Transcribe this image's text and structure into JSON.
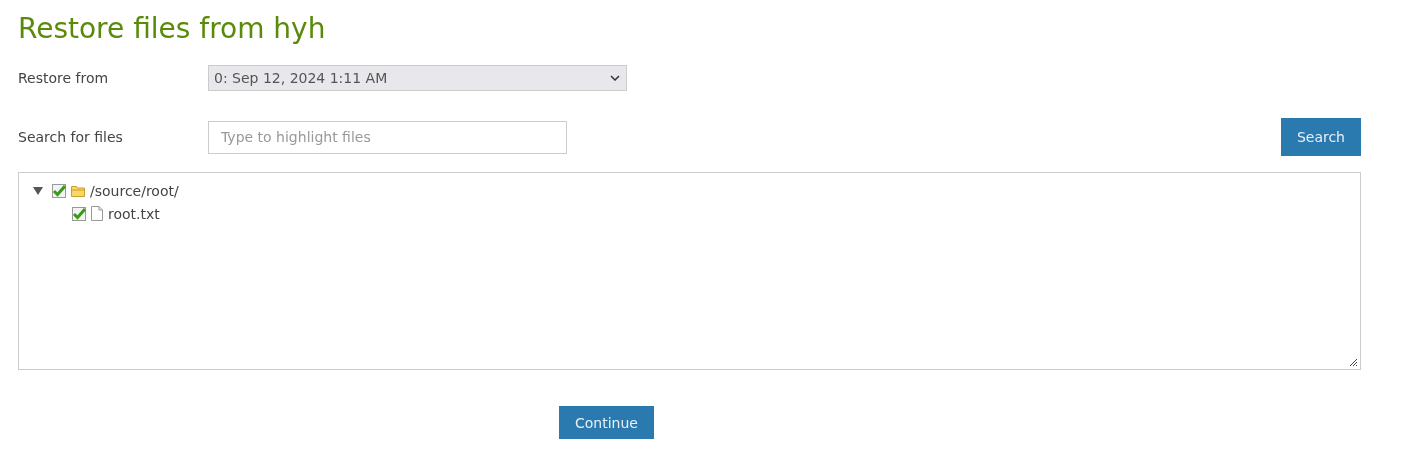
{
  "title": "Restore files from hyh",
  "restore_from": {
    "label": "Restore from",
    "value": "0: Sep 12, 2024 1:11 AM"
  },
  "search": {
    "label": "Search for files",
    "placeholder": "Type to highlight files",
    "button": "Search"
  },
  "tree": [
    {
      "name": "/source/root/",
      "kind": "folder",
      "expanded": true,
      "checked": true,
      "children": [
        {
          "name": "root.txt",
          "kind": "file",
          "checked": true
        }
      ]
    }
  ],
  "continue_button": "Continue"
}
